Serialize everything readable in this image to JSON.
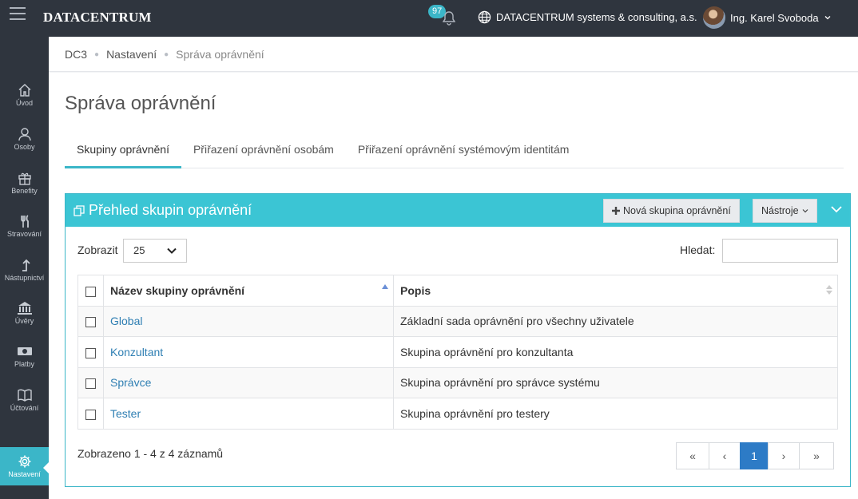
{
  "header": {
    "logo": "DATACENTRUM",
    "notification_count": "97",
    "organization": "DATACENTRUM systems & consulting, a.s.",
    "user_name": "Ing. Karel Svoboda"
  },
  "sidebar": {
    "items": [
      {
        "label": "Úvod",
        "icon": "home-icon"
      },
      {
        "label": "Osoby",
        "icon": "users-icon"
      },
      {
        "label": "Benefity",
        "icon": "gift-icon"
      },
      {
        "label": "Stravování",
        "icon": "cutlery-icon"
      },
      {
        "label": "Nástupnictví",
        "icon": "arrow-up-icon"
      },
      {
        "label": "Úvěry",
        "icon": "bank-icon"
      },
      {
        "label": "Platby",
        "icon": "money-icon"
      },
      {
        "label": "Účtování",
        "icon": "book-icon"
      },
      {
        "label": "Nastavení",
        "icon": "gear-icon",
        "active": true
      }
    ]
  },
  "breadcrumb": {
    "items": [
      "DC3",
      "Nastavení",
      "Správa oprávnění"
    ]
  },
  "page": {
    "title": "Správa oprávnění",
    "tabs": [
      {
        "label": "Skupiny oprávnění",
        "active": true
      },
      {
        "label": "Přiřazení oprávnění osobám"
      },
      {
        "label": "Přiřazení oprávnění systémovým identitám"
      }
    ]
  },
  "panel": {
    "title": "Přehled skupin oprávnění",
    "new_button": "Nová skupina oprávnění",
    "tools_button": "Nástroje",
    "show_label": "Zobrazit",
    "page_size": "25",
    "search_label": "Hledat:",
    "search_value": "",
    "columns": [
      "Název skupiny oprávnění",
      "Popis"
    ],
    "rows": [
      {
        "name": "Global",
        "description": "Základní sada oprávnění pro všechny uživatele"
      },
      {
        "name": "Konzultant",
        "description": "Skupina oprávnění pro konzultanta"
      },
      {
        "name": "Správce",
        "description": "Skupina oprávnění pro správce systému"
      },
      {
        "name": "Tester",
        "description": "Skupina oprávnění pro testery"
      }
    ],
    "info": "Zobrazeno 1 - 4 z 4 záznamů",
    "pagination": {
      "first": "«",
      "prev": "‹",
      "current": "1",
      "next": "›",
      "last": "»"
    }
  },
  "colors": {
    "topbar": "#2f353e",
    "accent": "#3bb6c8",
    "panel_header": "#3bc5d4",
    "link": "#2f7fb3",
    "pager_active": "#2d7bc6"
  }
}
